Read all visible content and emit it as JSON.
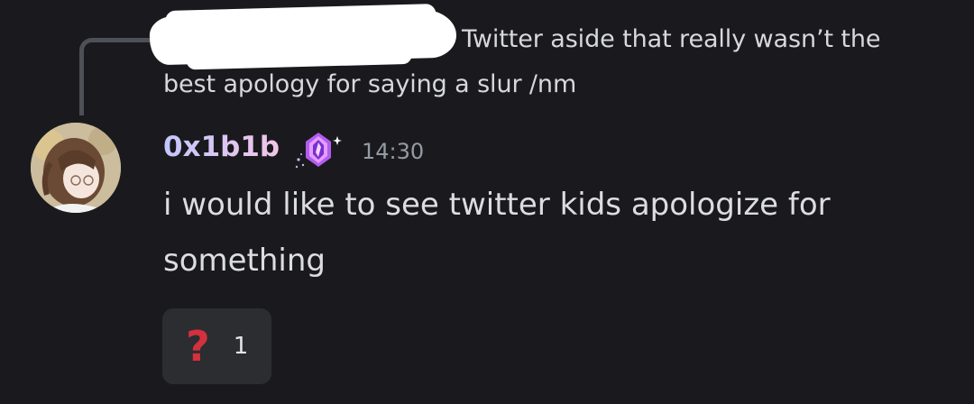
{
  "reply": {
    "text_line1": "Twitter aside that really wasn’t the",
    "text_line2": "best apology for saying a slur /nm"
  },
  "message": {
    "author": "0x1b1b",
    "badge_icon": "crystal-badge-icon",
    "timestamp": "14:30",
    "line1": "i would like to see twitter kids apologize  for",
    "line2": "something",
    "username_gradient": [
      "#c3c6ff",
      "#f2c6e6"
    ]
  },
  "reaction": {
    "emoji": "?",
    "count": "1",
    "emoji_color": "#d5303d"
  },
  "colors": {
    "background": "#1a1a1e",
    "reaction_bg": "#2b2d31",
    "timestamp": "#949ba4"
  }
}
